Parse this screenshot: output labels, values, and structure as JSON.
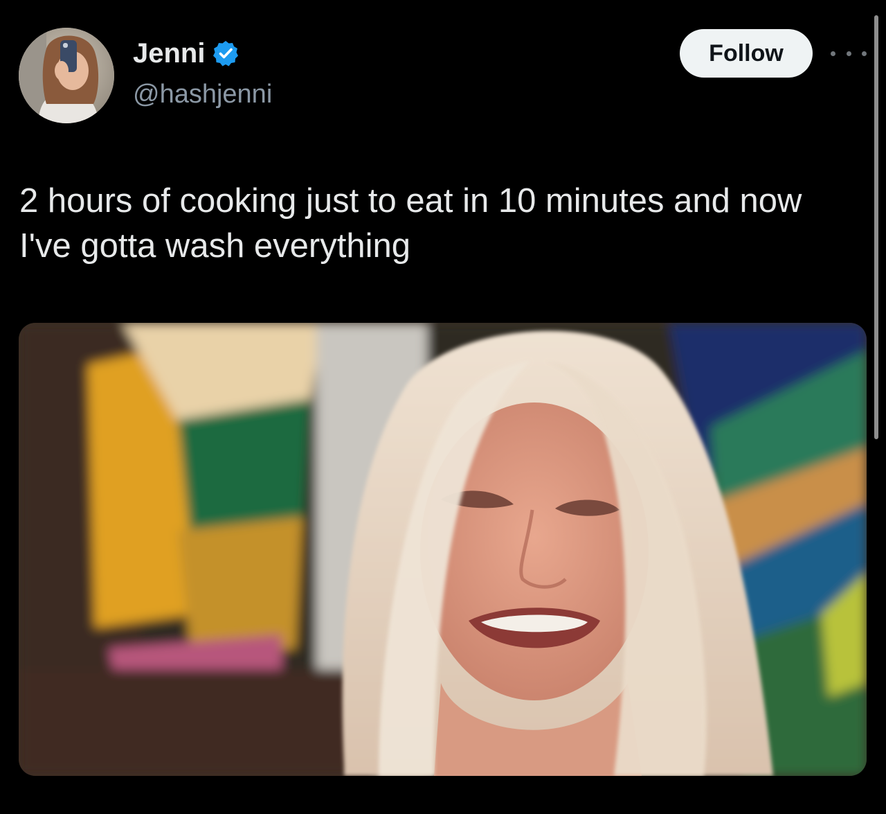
{
  "author": {
    "display_name": "Jenni",
    "handle": "@hashjenni",
    "verified": true,
    "avatar_icon": "profile-photo"
  },
  "actions": {
    "follow_label": "Follow",
    "more_icon": "more-options-icon"
  },
  "tweet": {
    "text": "2 hours of cooking just to eat in 10 minutes and now I've gotta wash everything"
  },
  "media": {
    "kind": "photo",
    "icon": "crying-woman-photo"
  },
  "colors": {
    "background": "#000000",
    "primary_text": "#e7e9ea",
    "secondary_text": "#8b98a5",
    "verified_blue": "#1d9bf0",
    "follow_button_bg": "#eff3f4"
  }
}
